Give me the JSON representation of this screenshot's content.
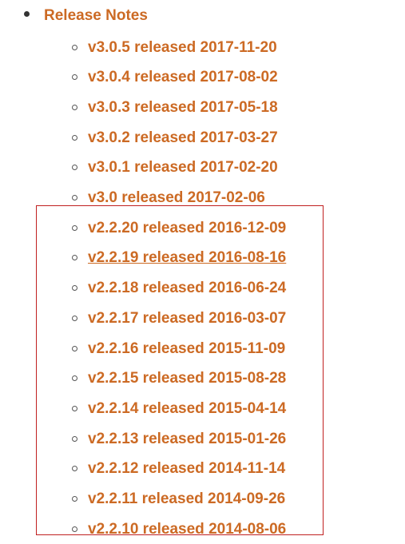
{
  "list": {
    "title_label": "Release Notes",
    "items": [
      {
        "label": "v3.0.5 released 2017-11-20",
        "hover": false
      },
      {
        "label": "v3.0.4 released 2017-08-02",
        "hover": false
      },
      {
        "label": "v3.0.3 released 2017-05-18",
        "hover": false
      },
      {
        "label": "v3.0.2 released 2017-03-27",
        "hover": false
      },
      {
        "label": "v3.0.1 released 2017-02-20",
        "hover": false
      },
      {
        "label": "v3.0 released 2017-02-06",
        "hover": false
      },
      {
        "label": "v2.2.20 released 2016-12-09",
        "hover": false
      },
      {
        "label": "v2.2.19 released 2016-08-16",
        "hover": true
      },
      {
        "label": "v2.2.18 released 2016-06-24",
        "hover": false
      },
      {
        "label": "v2.2.17 released 2016-03-07",
        "hover": false
      },
      {
        "label": "v2.2.16 released 2015-11-09",
        "hover": false
      },
      {
        "label": "v2.2.15 released 2015-08-28",
        "hover": false
      },
      {
        "label": "v2.2.14 released 2015-04-14",
        "hover": false
      },
      {
        "label": "v2.2.13 released 2015-01-26",
        "hover": false
      },
      {
        "label": "v2.2.12 released 2014-11-14",
        "hover": false
      },
      {
        "label": "v2.2.11 released 2014-09-26",
        "hover": false
      },
      {
        "label": "v2.2.10 released 2014-08-06",
        "hover": false
      }
    ]
  },
  "colors": {
    "link": "#cc6a24",
    "highlight_border": "#c02020"
  }
}
